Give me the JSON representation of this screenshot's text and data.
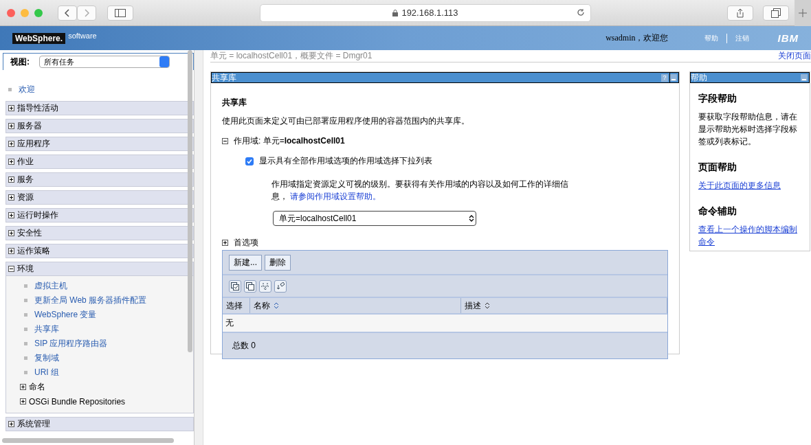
{
  "browser": {
    "url": "192.168.1.113"
  },
  "banner": {
    "logo": "WebSphere.",
    "product": "software",
    "user": "wsadmin，欢迎您",
    "links": [
      "帮助",
      "注销"
    ],
    "brand": "IBM"
  },
  "breadcrumb": {
    "text": "单元 = localhostCell01，概要文件 = Dmgr01",
    "close_link": "关闭页面"
  },
  "sidebar": {
    "view_label": "视图:",
    "view_value": "所有任务",
    "welcome": "欢迎",
    "items": [
      {
        "label": "指导性活动",
        "expanded": false
      },
      {
        "label": "服务器",
        "expanded": false
      },
      {
        "label": "应用程序",
        "expanded": false
      },
      {
        "label": "作业",
        "expanded": false
      },
      {
        "label": "服务",
        "expanded": false
      },
      {
        "label": "资源",
        "expanded": false
      },
      {
        "label": "运行时操作",
        "expanded": false
      },
      {
        "label": "安全性",
        "expanded": false
      },
      {
        "label": "运作策略",
        "expanded": false
      },
      {
        "label": "环境",
        "expanded": true,
        "children": [
          {
            "kind": "link",
            "label": "虚拟主机"
          },
          {
            "kind": "link",
            "label": "更新全局 Web 服务器插件配置"
          },
          {
            "kind": "link",
            "label": "WebSphere 变量"
          },
          {
            "kind": "link",
            "label": "共享库"
          },
          {
            "kind": "link",
            "label": "SIP 应用程序路由器"
          },
          {
            "kind": "link",
            "label": "复制域"
          },
          {
            "kind": "link",
            "label": "URI 组"
          },
          {
            "kind": "group",
            "label": "命名",
            "expanded": false
          },
          {
            "kind": "group",
            "label": "OSGi Bundle Repositories",
            "expanded": false
          }
        ]
      },
      {
        "label": "系统管理",
        "expanded": false
      }
    ]
  },
  "main": {
    "title": "共享库",
    "help_button": "?",
    "heading": "共享库",
    "description": "使用此页面来定义可由已部署应用程序使用的容器范围内的共享库。",
    "scope": {
      "expanded": true,
      "label": "作用域: 单元=**localhostCell01**",
      "checkbox_label": "显示具有全部作用域选项的作用域选择下拉列表",
      "checked": true,
      "info": "作用域指定资源定义可视的级别。要获得有关作用域的内容以及如何工作的详细信息，",
      "info_link": "请参阅作用域设置帮助。",
      "select_value": "单元=localhostCell01"
    },
    "preferences": {
      "label": "首选项",
      "expanded": false
    },
    "buttons": [
      "新建...",
      "删除"
    ],
    "table": {
      "columns": [
        "选择",
        "名称",
        "描述"
      ],
      "empty_text": "无",
      "total": "总数 0"
    }
  },
  "help": {
    "title": "帮助",
    "sections": [
      {
        "heading": "字段帮助",
        "kind": "text",
        "text": "要获取字段帮助信息，请在显示帮助光标时选择字段标签或列表标记。"
      },
      {
        "heading": "页面帮助",
        "kind": "link",
        "text": "关于此页面的更多信息"
      },
      {
        "heading": "命令辅助",
        "kind": "link",
        "text": "查看上一个操作的脚本编制命令"
      }
    ]
  }
}
